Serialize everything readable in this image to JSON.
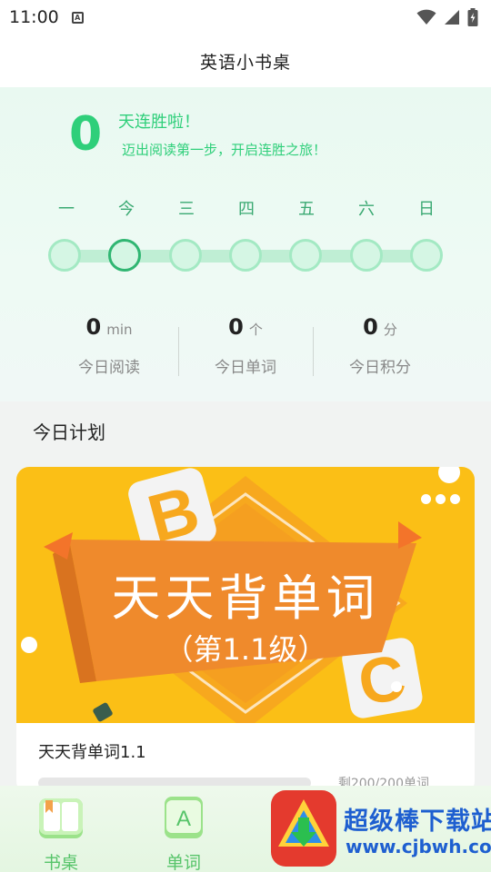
{
  "status_bar": {
    "time": "11:00",
    "a_icon_letter": "A"
  },
  "header": {
    "title": "英语小书桌"
  },
  "streak": {
    "count": "0",
    "title": "天连胜啦！",
    "subtitle": "迈出阅读第一步，开启连胜之旅！",
    "days": [
      "一",
      "今",
      "三",
      "四",
      "五",
      "六",
      "日"
    ]
  },
  "stats": [
    {
      "value": "0",
      "unit": "min",
      "label": "今日阅读"
    },
    {
      "value": "0",
      "unit": "个",
      "label": "今日单词"
    },
    {
      "value": "0",
      "unit": "分",
      "label": "今日积分"
    }
  ],
  "plan": {
    "heading": "今日计划",
    "banner_title": "天天背单词",
    "banner_subtitle": "（第1.1级）",
    "card_title": "天天背单词1.1",
    "progress_text": "剩200/200单词",
    "progress_fraction": 0
  },
  "nav": [
    {
      "label": "书桌",
      "icon": "book-icon"
    },
    {
      "label": "单词",
      "icon": "word-card-icon",
      "icon_letter": "A"
    }
  ],
  "watermark": {
    "text": "超级棒下载站",
    "url": "www.cjbwh.com"
  },
  "colors": {
    "accent_green": "#2fcf7a",
    "banner_yellow": "#fbbf16",
    "banner_orange": "#f0862e",
    "nav_green": "#57c46a"
  }
}
